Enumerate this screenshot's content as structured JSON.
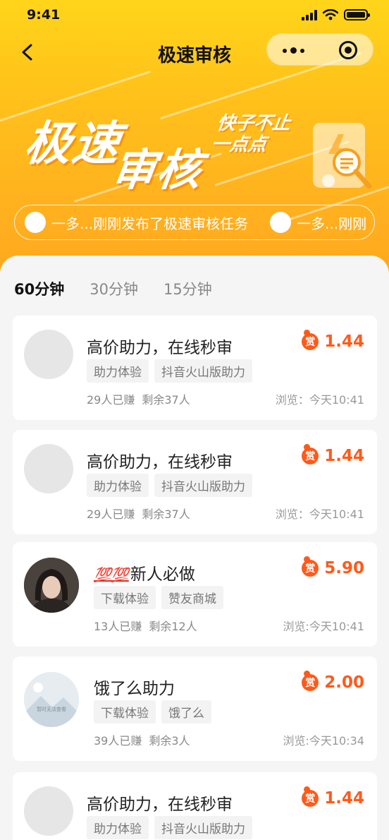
{
  "status": {
    "time": "9:41"
  },
  "nav": {
    "title": "极速审核"
  },
  "hero": {
    "title_line1": "极速",
    "title_line2": "审核",
    "subtitle_line1": "快子不止",
    "subtitle_line2": "一点点"
  },
  "ticker": [
    {
      "text": "一多...刚刚发布了极速审核任务"
    },
    {
      "text": "一多...刚刚"
    }
  ],
  "tabs": [
    {
      "label": "60分钟",
      "active": true
    },
    {
      "label": "30分钟",
      "active": false
    },
    {
      "label": "15分钟",
      "active": false
    }
  ],
  "tasks": [
    {
      "title": "高价助力，在线秒审",
      "tags": [
        "助力体验",
        "抖音火山版助力"
      ],
      "earned": "29人已赚",
      "remaining": "剩余37人",
      "views": "浏览：今天10:41",
      "badge": "赏",
      "reward": "1.44",
      "avatar": "placeholder"
    },
    {
      "title": "高价助力，在线秒审",
      "tags": [
        "助力体验",
        "抖音火山版助力"
      ],
      "earned": "29人已赚",
      "remaining": "剩余37人",
      "views": "浏览：今天10:41",
      "badge": "赏",
      "reward": "1.44",
      "avatar": "placeholder"
    },
    {
      "title_prefix": "💯💯",
      "title": "新人必做",
      "tags": [
        "下载体验",
        "赞友商城"
      ],
      "earned": "13人已赚",
      "remaining": "剩余12人",
      "views": "浏览:今天10:41",
      "badge": "赏",
      "reward": "5.90",
      "avatar": "photo"
    },
    {
      "title": "饿了么助力",
      "tags": [
        "下载体验",
        "饿了么"
      ],
      "earned": "39人已赚",
      "remaining": "剩余3人",
      "views": "浏览:今天10:34",
      "badge": "赏",
      "reward": "2.00",
      "avatar": "no-image",
      "avatar_caption": "暂时无法查看"
    },
    {
      "title": "高价助力，在线秒审",
      "tags": [
        "助力体验",
        "抖音火山版助力"
      ],
      "earned": "",
      "remaining": "",
      "views": "",
      "badge": "赏",
      "reward": "1.44",
      "avatar": "placeholder"
    }
  ],
  "colors": {
    "accent": "#ffc21a",
    "reward": "#ff5a1a"
  }
}
